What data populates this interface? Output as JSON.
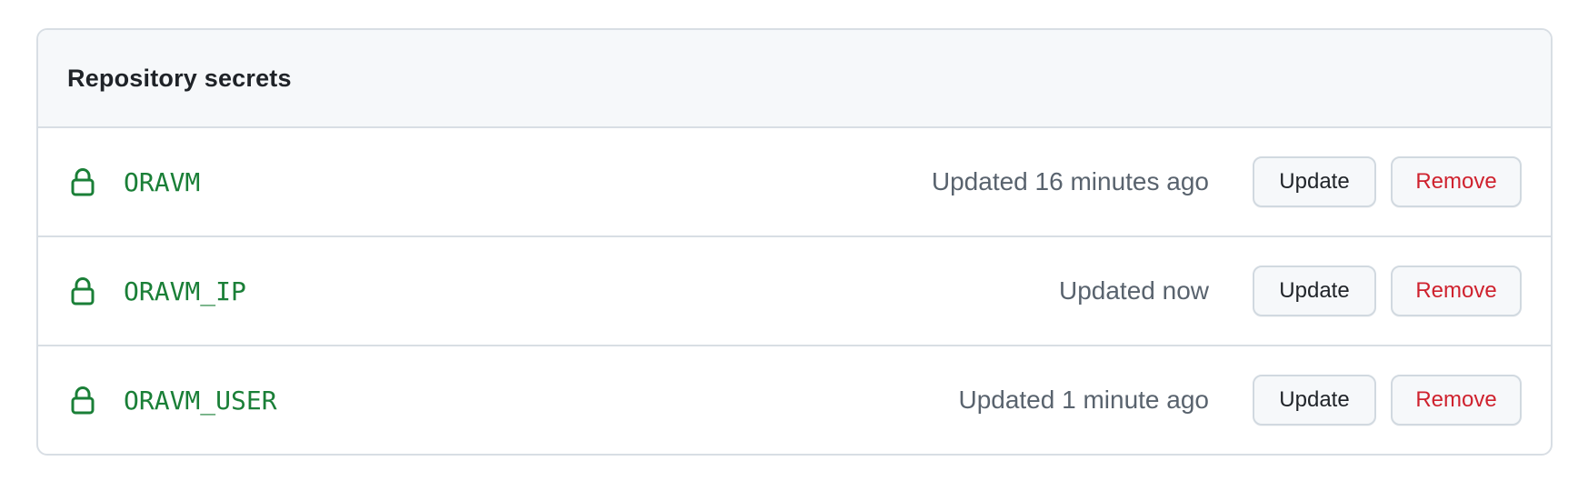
{
  "panel": {
    "title": "Repository secrets"
  },
  "secrets": [
    {
      "name": "ORAVM",
      "updated": "Updated 16 minutes ago",
      "update_label": "Update",
      "remove_label": "Remove"
    },
    {
      "name": "ORAVM_IP",
      "updated": "Updated now",
      "update_label": "Update",
      "remove_label": "Remove"
    },
    {
      "name": "ORAVM_USER",
      "updated": "Updated 1 minute ago",
      "update_label": "Update",
      "remove_label": "Remove"
    }
  ],
  "icons": {
    "secret": "lock-icon"
  },
  "colors": {
    "secret_name": "#1a7f37",
    "remove": "#cf222e",
    "header_bg": "#f6f8fa",
    "border": "#d8dee4"
  }
}
